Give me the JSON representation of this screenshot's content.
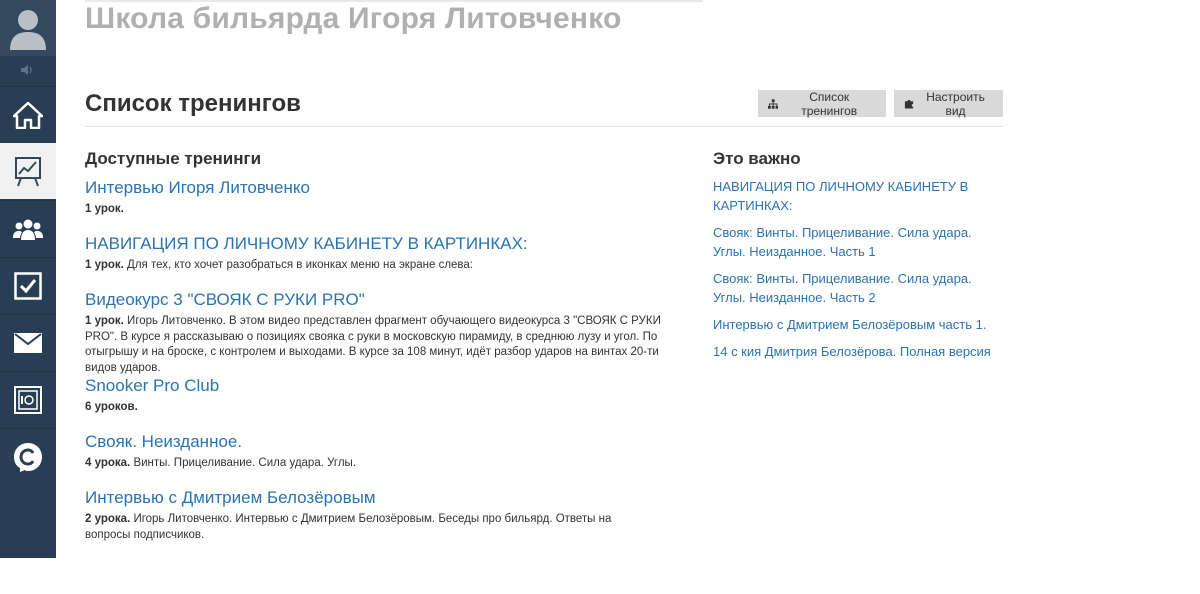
{
  "school": {
    "title": "Школа бильярда Игоря Литовченко"
  },
  "sidebar": {
    "items": [
      {
        "icon": "home-icon",
        "active": false
      },
      {
        "icon": "chart-board-icon",
        "active": true
      },
      {
        "icon": "users-icon",
        "active": false
      },
      {
        "icon": "checkbox-icon",
        "active": false
      },
      {
        "icon": "mail-icon",
        "active": false
      },
      {
        "icon": "safe-icon",
        "active": false
      },
      {
        "icon": "c-logo-icon",
        "active": false
      }
    ]
  },
  "header": {
    "title": "Список тренингов",
    "btn_list_label": "Список тренингов",
    "btn_view_label": "Настроить вид"
  },
  "available": {
    "title": "Доступные тренинги",
    "trainings": [
      {
        "name": "Интервью Игоря Литовченко",
        "lessons": "1 урок.",
        "desc": ""
      },
      {
        "name": "НАВИГАЦИЯ ПО ЛИЧНОМУ КАБИНЕТУ В КАРТИНКАХ:",
        "lessons": "1 урок.",
        "desc": "Для тех, кто хочет разобраться в иконках меню на экране слева:"
      },
      {
        "name": "Видеокурс 3 \"СВОЯК С РУКИ PRO\"",
        "lessons": "1 урок.",
        "desc": "Игорь Литовченко. В этом видео представлен фрагмент обучающего видеокурса 3 \"СВОЯК С РУКИ PRO\". В курсе я рассказываю о позициях свояка с руки в московскую пирамиду, в среднюю лузу и угол. По отыгрышу и на броске, с контролем и выходами. В курсе за 108 минут, идёт разбор ударов на винтах 20-ти видов ударов."
      },
      {
        "name": "Snooker Pro Club",
        "lessons": "6 уроков.",
        "desc": ""
      },
      {
        "name": "Свояк. Неизданное.",
        "lessons": "4 урока.",
        "desc": "Винты. Прицеливание. Сила удара. Углы."
      },
      {
        "name": "Интервью с Дмитрием Белозёровым",
        "lessons": "2 урока.",
        "desc": "Игорь Литовченко. Интервью с Дмитрием Белозёровым. Беседы про бильярд. Ответы на вопросы подписчиков."
      }
    ]
  },
  "important": {
    "title": "Это важно",
    "links": [
      "НАВИГАЦИЯ ПО ЛИЧНОМУ КАБИНЕТУ В КАРТИНКАХ:",
      "Свояк: Винты. Прицеливание. Сила удара. Углы. Неизданное. Часть 1",
      "Свояк: Винты. Прицеливание. Сила удара. Углы. Неизданное. Часть 2",
      "Интервью с Дмитрием Белозёровым часть 1.",
      "14 с кия Дмитрия Белозёрова. Полная версия"
    ]
  },
  "colors": {
    "sidebar": "#283e54",
    "link": "#2a73b0",
    "button": "#d9d9d9"
  }
}
